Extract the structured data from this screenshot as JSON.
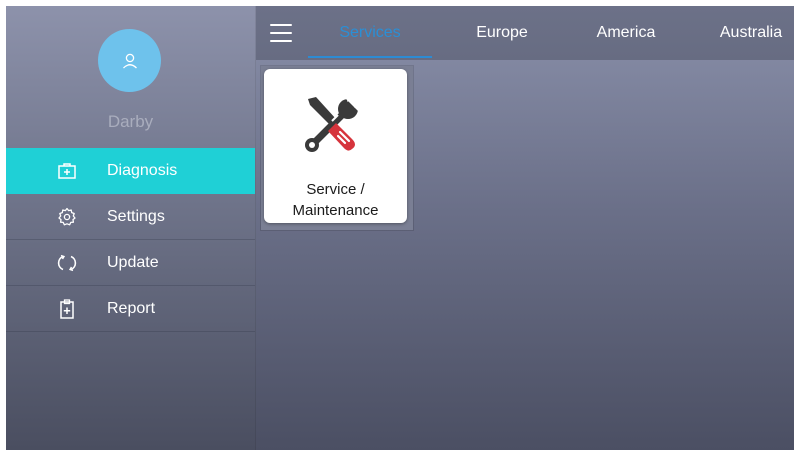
{
  "user": {
    "name": "Darby",
    "avatar_icon": "user-icon"
  },
  "sidebar": {
    "items": [
      {
        "label": "Diagnosis",
        "icon": "medical-kit-icon",
        "active": true
      },
      {
        "label": "Settings",
        "icon": "gear-icon",
        "active": false
      },
      {
        "label": "Update",
        "icon": "refresh-icon",
        "active": false
      },
      {
        "label": "Report",
        "icon": "clipboard-icon",
        "active": false
      }
    ]
  },
  "header": {
    "menu_icon": "hamburger-menu-icon",
    "tabs": [
      {
        "label": "Services",
        "active": true
      },
      {
        "label": "Europe",
        "active": false
      },
      {
        "label": "America",
        "active": false
      },
      {
        "label": "Australia",
        "active": false
      }
    ]
  },
  "main": {
    "tiles": [
      {
        "label_line1": "Service /",
        "label_line2": "Maintenance",
        "icon": "wrench-screwdriver-icon"
      }
    ]
  },
  "colors": {
    "accent_active": "#1fd0d6",
    "tab_active": "#2a8fd6",
    "avatar": "#6ec2ec",
    "tool_red": "#d6343c"
  }
}
